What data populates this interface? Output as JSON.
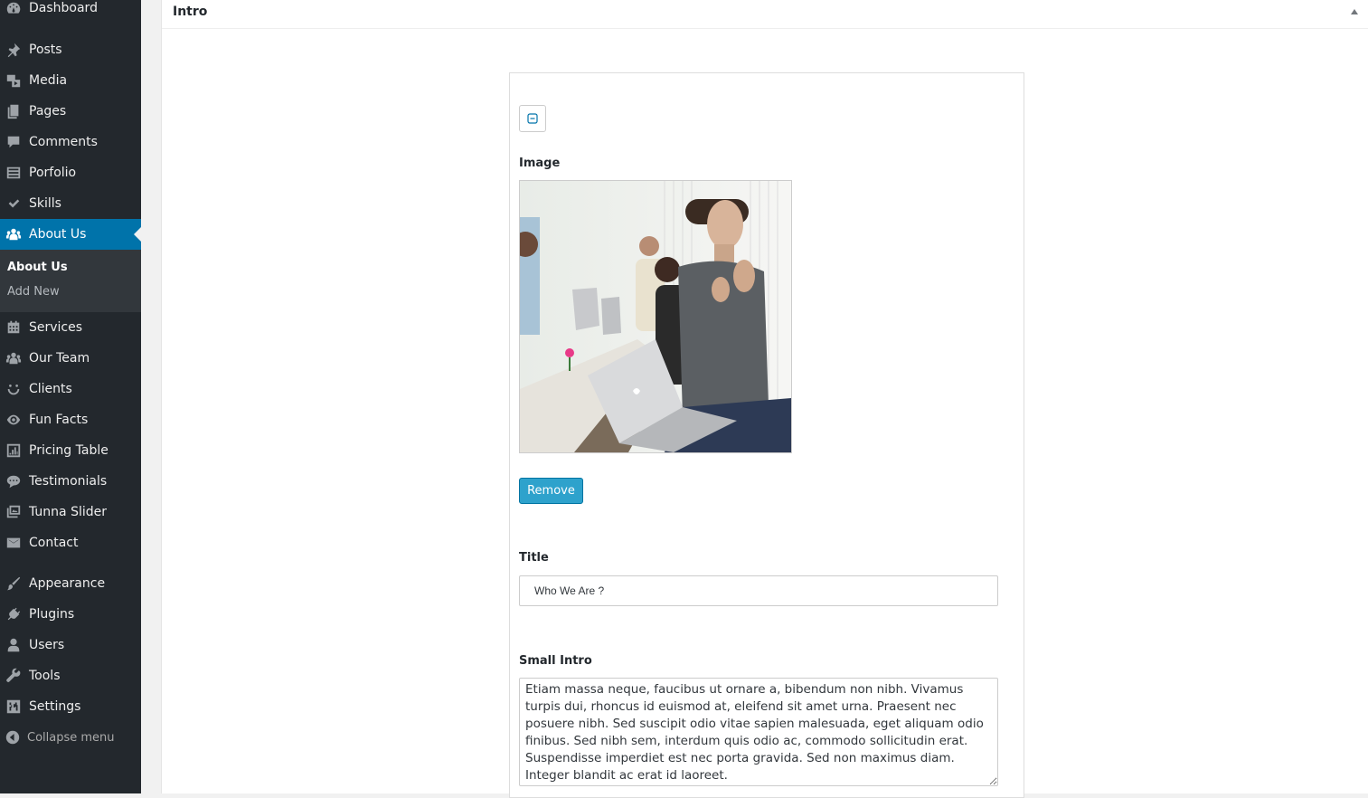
{
  "sidebar": {
    "items": [
      {
        "label": "Dashboard",
        "icon": "dashboard-icon"
      },
      {
        "label": "Posts",
        "icon": "pushpin-icon"
      },
      {
        "label": "Media",
        "icon": "media-icon"
      },
      {
        "label": "Pages",
        "icon": "pages-icon"
      },
      {
        "label": "Comments",
        "icon": "comment-icon"
      },
      {
        "label": "Porfolio",
        "icon": "list-icon"
      },
      {
        "label": "Skills",
        "icon": "checkmark-icon"
      },
      {
        "label": "About Us",
        "icon": "groups-icon"
      },
      {
        "label": "Services",
        "icon": "calendar-icon"
      },
      {
        "label": "Our Team",
        "icon": "groups-icon"
      },
      {
        "label": "Clients",
        "icon": "smiley-icon"
      },
      {
        "label": "Fun Facts",
        "icon": "eye-icon"
      },
      {
        "label": "Pricing Table",
        "icon": "chart-icon"
      },
      {
        "label": "Testimonials",
        "icon": "speech-bubble-icon"
      },
      {
        "label": "Tunna Slider",
        "icon": "gallery-icon"
      },
      {
        "label": "Contact",
        "icon": "envelope-icon"
      },
      {
        "label": "Appearance",
        "icon": "paintbrush-icon"
      },
      {
        "label": "Plugins",
        "icon": "plug-icon"
      },
      {
        "label": "Users",
        "icon": "user-icon"
      },
      {
        "label": "Tools",
        "icon": "wrench-icon"
      },
      {
        "label": "Settings",
        "icon": "settings-icon"
      }
    ],
    "current": "About Us",
    "submenu": [
      {
        "label": "About Us"
      },
      {
        "label": "Add New"
      }
    ],
    "collapse_label": "Collapse menu"
  },
  "panel": {
    "title": "Intro"
  },
  "form": {
    "image_label": "Image",
    "remove_label": "Remove",
    "title_label": "Title",
    "title_value": "Who We Are ?",
    "intro_label": "Small Intro",
    "intro_value": "Etiam massa neque, faucibus ut ornare a, bibendum non nibh. Vivamus turpis dui, rhoncus id euismod at, eleifend sit amet urna. Praesent nec posuere nibh. Sed suscipit odio vitae sapien malesuada, eget aliquam odio finibus. Sed nibh sem, interdum quis odio ac, commodo sollicitudin erat. Suspendisse imperdiet est nec porta gravida. Sed non maximus diam. Integer blandit ac erat id laoreet."
  },
  "colors": {
    "sidebar_bg": "#23282d",
    "accent": "#0073aa",
    "button": "#2ea2cc"
  }
}
